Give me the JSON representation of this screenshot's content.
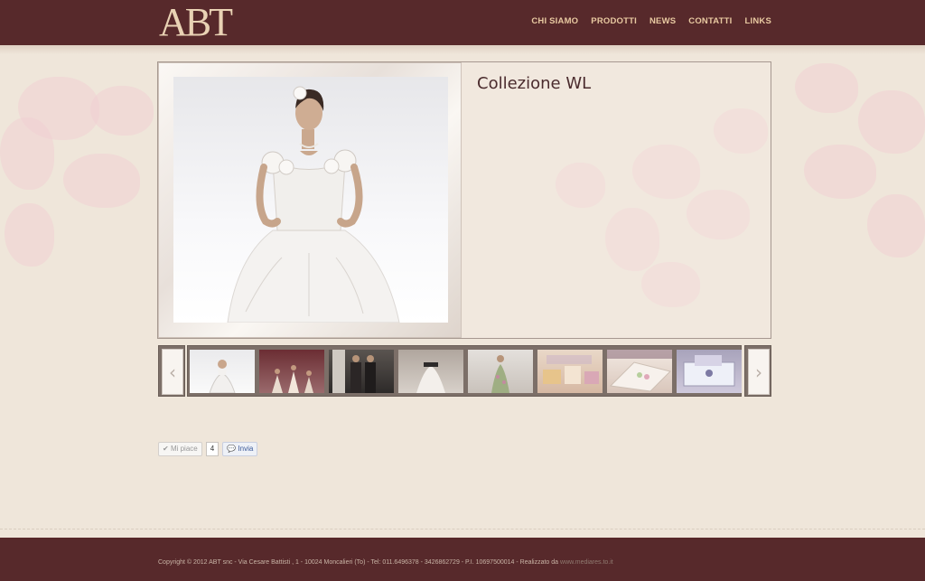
{
  "header": {
    "logo_text": "ABT",
    "nav": [
      "CHI SIAMO",
      "PRODOTTI",
      "NEWS",
      "CONTATTI",
      "LINKS"
    ]
  },
  "main": {
    "collection_title": "Collezione WL",
    "thumbnails": [
      "bride-white-gown",
      "bridal-party",
      "couple-suit",
      "black-sash-gown",
      "floral-gown",
      "gift-boxes",
      "embroidered-linen",
      "blue-stationery"
    ]
  },
  "social": {
    "like_label": "Mi piace",
    "like_count": "4",
    "send_label": "Invia"
  },
  "footer": {
    "copyright": "Copyright © 2012 ABT snc - Via Cesare Battisti , 1 - 10024 Moncalieri (To) - Tel: 011.6496378 - 3426862729 - P.I. 10697500014 - Realizzato da ",
    "credit": "www.mediares.to.it"
  },
  "colors": {
    "header_bg": "#57292b",
    "nav_text": "#e8c9a1",
    "page_bg": "#efe6da",
    "title_text": "#4a2b2d"
  }
}
